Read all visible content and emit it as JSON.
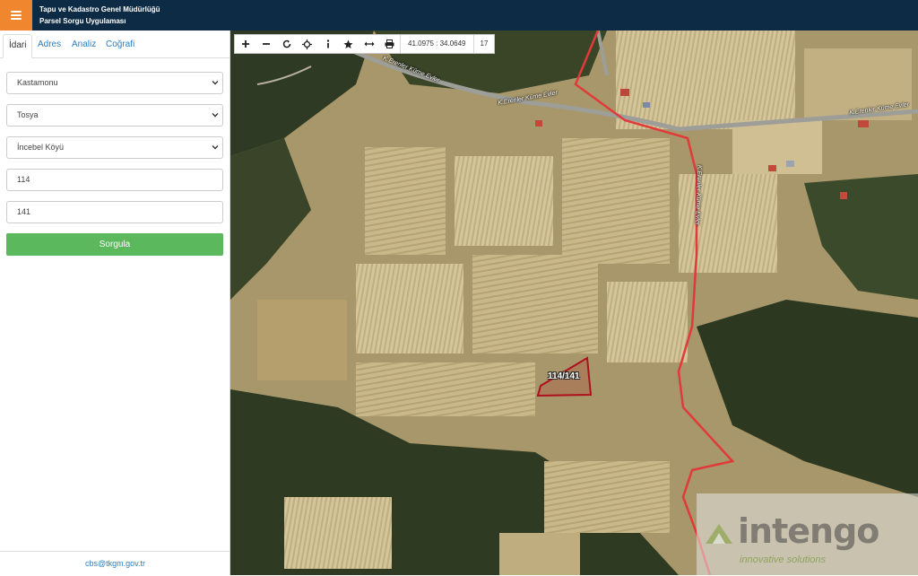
{
  "header": {
    "title_line1": "Tapu ve Kadastro Genel Müdürlüğü",
    "title_line2": "Parsel Sorgu Uygulaması",
    "menu_icon": "hamburger-icon",
    "accent_color": "#f0862e",
    "bar_color": "#0d2b45"
  },
  "tabs": [
    {
      "label": "İdari",
      "active": true
    },
    {
      "label": "Adres",
      "active": false
    },
    {
      "label": "Analiz",
      "active": false
    },
    {
      "label": "Coğrafi",
      "active": false
    }
  ],
  "form": {
    "province": "Kastamonu",
    "district": "Tosya",
    "neighborhood": "İncebel Köyü",
    "block": "114",
    "parcel": "141",
    "submit_label": "Sorgula",
    "submit_color": "#5cb85c"
  },
  "footer": {
    "email": "cbs@tkgm.gov.tr"
  },
  "map": {
    "coordinates": "41.0975 : 34.0649",
    "zoom": "17",
    "parcel_label": "114/141",
    "road_labels": [
      "K.Erenler Küme Evler",
      "K.Erenler Küme Evler",
      "K.Erenler Küme Evler",
      "K.Erenler Küme Evler"
    ],
    "toolbar_icons": [
      "zoom-in-icon",
      "zoom-out-icon",
      "refresh-icon",
      "locate-icon",
      "info-icon",
      "favorite-icon",
      "measure-icon",
      "print-icon"
    ],
    "boundary_color": "#e03a3a",
    "parcel_color": "#b0101c"
  },
  "watermark": {
    "brand": "intengo",
    "tagline": "innovative solutions"
  }
}
